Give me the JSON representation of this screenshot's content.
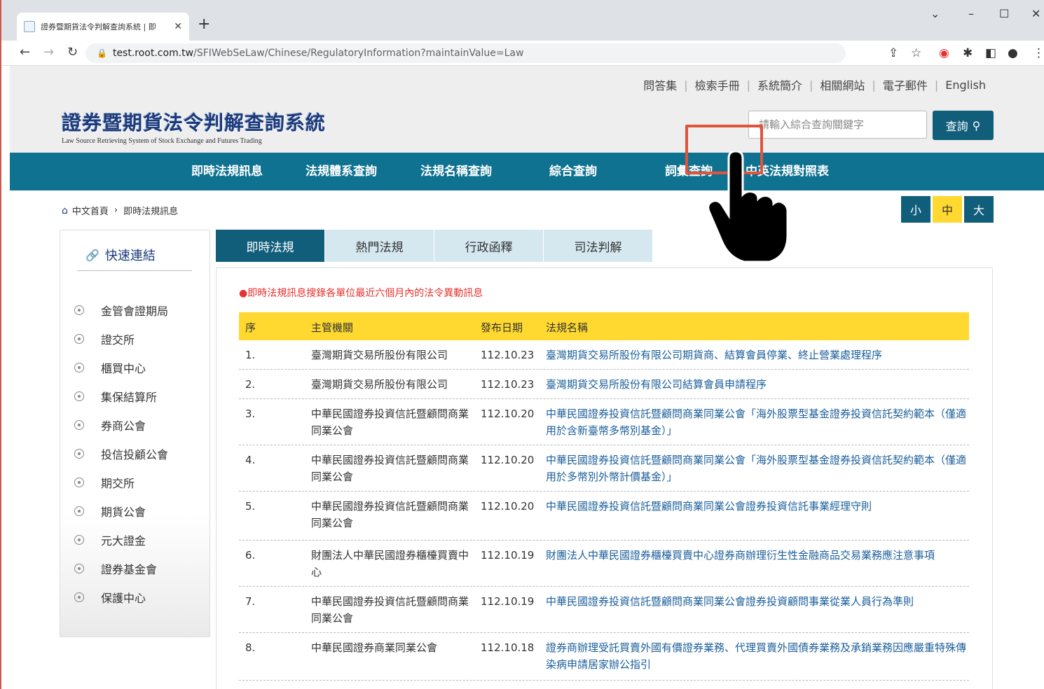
{
  "browser": {
    "tab_title": "證券暨期貨法令判解查詢系統 | 即",
    "tab_close": "✕",
    "new_tab": "+",
    "url_host": "test.root.com.tw",
    "url_path": "/SFIWebSeLaw/Chinese/RegulatoryInformation?maintainValue=Law"
  },
  "top_links": [
    "問答集",
    "檢索手冊",
    "系統簡介",
    "相關網站",
    "電子郵件",
    "English"
  ],
  "logo": {
    "zh": "證券暨期貨法令判解查詢系統",
    "en": "Law Source Retrieving System of Stock Exchange and Futures Trading"
  },
  "search": {
    "placeholder": "請輸入綜合查詢關鍵字",
    "button": "查詢"
  },
  "main_nav": [
    "即時法規訊息",
    "法規體系查詢",
    "法規名稱查詢",
    "綜合查詢",
    "詞彙查詢",
    "中英法規對照表"
  ],
  "breadcrumb": [
    "中文首頁",
    "即時法規訊息"
  ],
  "font_size": [
    "小",
    "中",
    "大"
  ],
  "sidebar": {
    "title": "快速連結",
    "items": [
      "金管會證期局",
      "證交所",
      "櫃買中心",
      "集保結算所",
      "券商公會",
      "投信投顧公會",
      "期交所",
      "期貨公會",
      "元大證金",
      "證券基金會",
      "保護中心"
    ]
  },
  "tabs": [
    "即時法規",
    "熱門法規",
    "行政函釋",
    "司法判解"
  ],
  "notice": "●即時法規訊息搜錄各單位最近六個月內的法令異動訊息",
  "table": {
    "headers": [
      "序",
      "主管機關",
      "發布日期",
      "法規名稱"
    ],
    "rows": [
      {
        "no": "1.",
        "agency": "臺灣期貨交易所股份有限公司",
        "date": "112.10.23",
        "title": "臺灣期貨交易所股份有限公司期貨商、結算會員停業、終止營業處理程序"
      },
      {
        "no": "2.",
        "agency": "臺灣期貨交易所股份有限公司",
        "date": "112.10.23",
        "title": "臺灣期貨交易所股份有限公司結算會員申請程序"
      },
      {
        "no": "3.",
        "agency": "中華民國證券投資信託暨顧問商業同業公會",
        "date": "112.10.20",
        "title": "中華民國證券投資信託暨顧問商業同業公會「海外股票型基金證券投資信託契約範本（僅適用於含新臺幣多幣別基金）」"
      },
      {
        "no": "4.",
        "agency": "中華民國證券投資信託暨顧問商業同業公會",
        "date": "112.10.20",
        "title": "中華民國證券投資信託暨顧問商業同業公會「海外股票型基金證券投資信託契約範本（僅適用於多幣別外幣計價基金）」"
      },
      {
        "no": "5.",
        "agency": "中華民國證券投資信託暨顧問商業同業公會",
        "date": "112.10.20",
        "title": "中華民國證券投資信託暨顧問商業同業公會證券投資信託事業經理守則"
      },
      {
        "no": "6.",
        "agency": "財團法人中華民國證券櫃檯買賣中心",
        "date": "112.10.19",
        "title": "財團法人中華民國證券櫃檯買賣中心證券商辦理衍生性金融商品交易業務應注意事項"
      },
      {
        "no": "7.",
        "agency": "中華民國證券投資信託暨顧問商業同業公會",
        "date": "112.10.19",
        "title": "中華民國證券投資信託暨顧問商業同業公會證券投資顧問事業從業人員行為準則"
      },
      {
        "no": "8.",
        "agency": "中華民國證券商業同業公會",
        "date": "112.10.18",
        "title": "證券商辦理受託買賣外國有價證券業務、代理買賣外國債券業務及承銷業務因應嚴重特殊傳染病申請居家辦公指引"
      }
    ]
  },
  "colors": {
    "nav_bg": "#0e7290",
    "active_tab": "#115e7b",
    "table_head": "#ffd930",
    "highlight": "#e0533c",
    "notice": "#e5322d"
  },
  "icons": [
    "lock-icon",
    "home-icon",
    "link-icon",
    "search-icon",
    "pointing-hand-icon"
  ]
}
